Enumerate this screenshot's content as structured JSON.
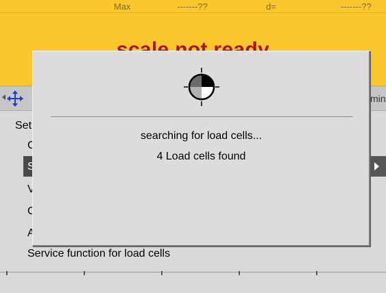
{
  "header": {
    "max_label": "Max",
    "max_value": "-------??",
    "d_label": "d=",
    "d_value": "-------??",
    "status": "scale not ready",
    "background_color": "#fcc72c",
    "status_color": "#b0121b"
  },
  "navbar": {
    "left_arrow_icon": "triangle-left-icon",
    "move_icon": "move-arrows-icon",
    "right_text": "min"
  },
  "menu": {
    "title": "Setup",
    "items": [
      {
        "label": "C"
      },
      {
        "label": "S"
      },
      {
        "label": "V"
      },
      {
        "label": "C"
      },
      {
        "label": "A"
      },
      {
        "label": "Service function for load cells"
      }
    ],
    "selected_index": 1,
    "side_arrow_icon": "triangle-right-icon"
  },
  "dialog": {
    "icon": "busy-spinner-icon",
    "line1": "searching for load cells...",
    "line2": "4 Load cells found"
  },
  "softkeys": [
    {
      "label": ""
    },
    {
      "label": ""
    },
    {
      "label": ""
    },
    {
      "label": ""
    },
    {
      "label": ""
    }
  ]
}
